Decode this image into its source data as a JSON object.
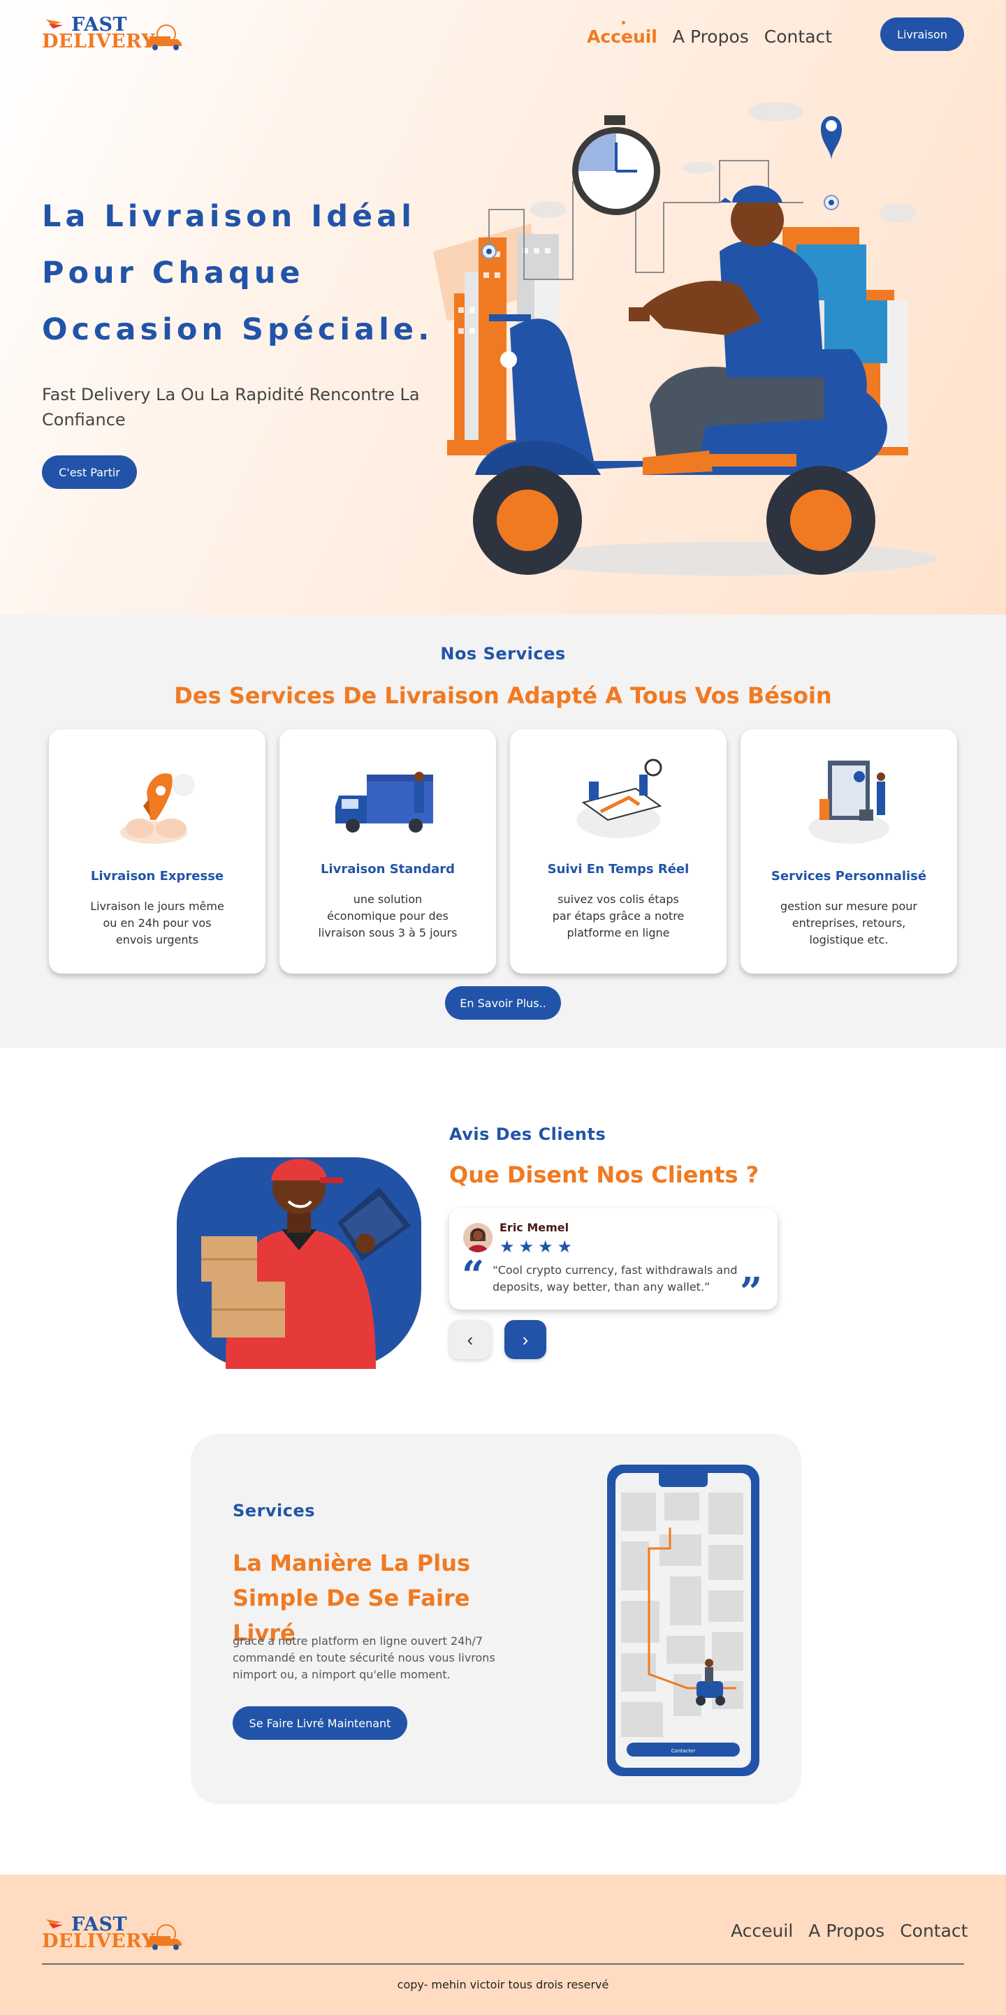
{
  "brand": {
    "line1": "FAST",
    "line2": "DELIVERY"
  },
  "nav": {
    "home": "Acceuil",
    "about": "A Propos",
    "contact": "Contact"
  },
  "header": {
    "cta_label": "Livraison"
  },
  "hero": {
    "title_lines": [
      "La Livraison Idéal",
      "Pour Chaque",
      "Occasion Spéciale."
    ],
    "subtitle": "Fast Delivery La Ou La Rapidité Rencontre La Confiance",
    "cta_label": "C'est Partir"
  },
  "services": {
    "label": "Nos Services",
    "title": "Des Services De Livraison Adapté A Tous Vos Bésoin",
    "cards": [
      {
        "title": "Livraison Expresse",
        "desc": "Livraison le jours même ou en 24h pour vos envois urgents"
      },
      {
        "title": "Livraison Standard",
        "desc": "une solution économique pour des livraison sous 3 à 5 jours"
      },
      {
        "title": "Suivi En Temps Réel",
        "desc": "suivez vos colis étaps par étaps grâce a notre platforme en ligne"
      },
      {
        "title": "Services Personnalisé",
        "desc": "gestion sur mesure pour entreprises, retours, logistique etc."
      }
    ],
    "more_label": "En Savoir Plus.."
  },
  "testimonials": {
    "label": "Avis Des Clients",
    "title": "Que Disent Nos Clients ?",
    "review": {
      "name": "Eric Memel",
      "rating": 4,
      "stars": "★★★★",
      "text": "“Cool crypto currency, fast withdrawals and deposits, way better, than any wallet.”"
    },
    "prev_icon": "chevron-left-icon",
    "next_icon": "chevron-right-icon"
  },
  "cta": {
    "label": "Services",
    "title": "La Manière La Plus Simple De Se Faire Livré",
    "desc": "grace a notre platform en ligne  ouvert 24h/7 commandé en toute sécurité nous vous livrons nimport ou, a nimport qu'elle moment.",
    "button_label": "Se Faire Livré Maintenant",
    "phone_button": "Contacter"
  },
  "footer": {
    "copyright": "copy- mehin victoir tous drois reservé"
  },
  "colors": {
    "primary": "#2154a8",
    "accent": "#f07a22",
    "hero_bg": "#ffe2cc",
    "footer_bg": "#ffdcc1",
    "section_bg": "#f3f3f3"
  }
}
